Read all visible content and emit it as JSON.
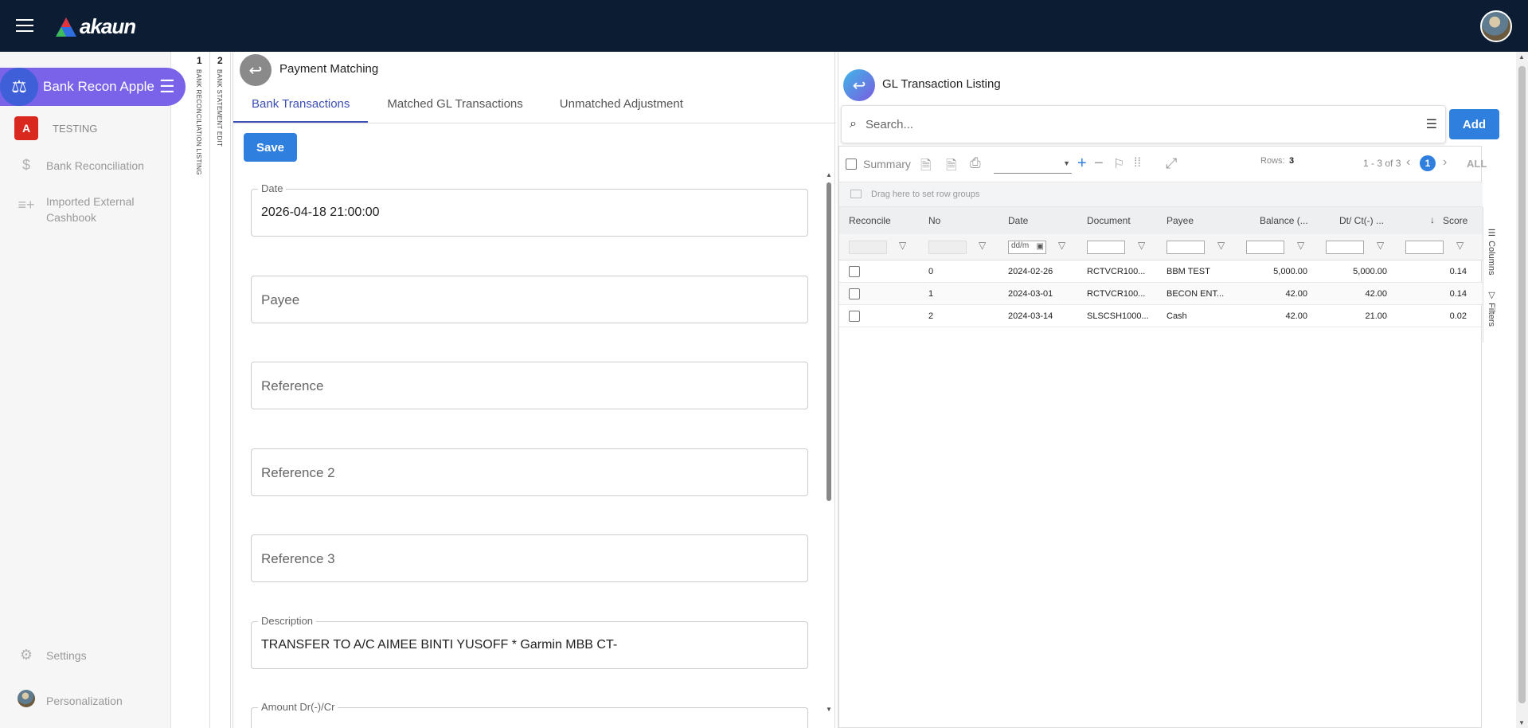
{
  "app": {
    "brand": "akaun",
    "app_name": "Bank Recon Apple"
  },
  "sidebar": {
    "items": [
      {
        "label": "TESTING",
        "icon": "adobe-icon"
      },
      {
        "label": "Bank Reconciliation",
        "icon": "dollar-icon"
      },
      {
        "label": "Imported External Cashbook",
        "icon": "playlist-add-icon"
      }
    ],
    "settings": "Settings",
    "personalization": "Personalization"
  },
  "vertical_tabs": [
    {
      "num": "1",
      "label": "BANK RECONCILIATION LISTING"
    },
    {
      "num": "2",
      "label": "BANK STATEMENT EDIT"
    }
  ],
  "payment": {
    "title": "Payment Matching",
    "tabs": [
      "Bank Transactions",
      "Matched GL Transactions",
      "Unmatched Adjustment"
    ],
    "save": "Save",
    "fields": {
      "date_label": "Date",
      "date_value": "2026-04-18 21:00:00",
      "payee": "Payee",
      "reference": "Reference",
      "reference2": "Reference 2",
      "reference3": "Reference 3",
      "description_label": "Description",
      "description_value": "TRANSFER TO A/C AIMEE BINTI YUSOFF * Garmin MBB CT-",
      "amount_label": "Amount Dr(-)/Cr"
    }
  },
  "gl": {
    "title": "GL Transaction Listing",
    "search_placeholder": "Search...",
    "add": "Add",
    "summary": "Summary",
    "rows_label": "Rows:",
    "rows_count": "3",
    "pagination": "1 - 3 of 3",
    "page": "1",
    "all": "ALL",
    "group_hint": "Drag here to set row groups",
    "date_filter_placeholder": "dd/m",
    "columns": [
      "Reconcile",
      "No",
      "Date",
      "Document",
      "Payee",
      "Balance (...",
      "Dt/ Ct(-) ...",
      "Score"
    ],
    "rows": [
      {
        "no": "0",
        "date": "2024-02-26",
        "document": "RCTVCR100...",
        "payee": "BBM TEST",
        "balance": "5,000.00",
        "dtct": "5,000.00",
        "score": "0.14"
      },
      {
        "no": "1",
        "date": "2024-03-01",
        "document": "RCTVCR100...",
        "payee": "BECON ENT...",
        "balance": "42.00",
        "dtct": "42.00",
        "score": "0.14"
      },
      {
        "no": "2",
        "date": "2024-03-14",
        "document": "SLSCSH1000...",
        "payee": "Cash",
        "balance": "42.00",
        "dtct": "21.00",
        "score": "0.02"
      }
    ],
    "side_tabs": [
      "Columns",
      "Filters"
    ]
  }
}
